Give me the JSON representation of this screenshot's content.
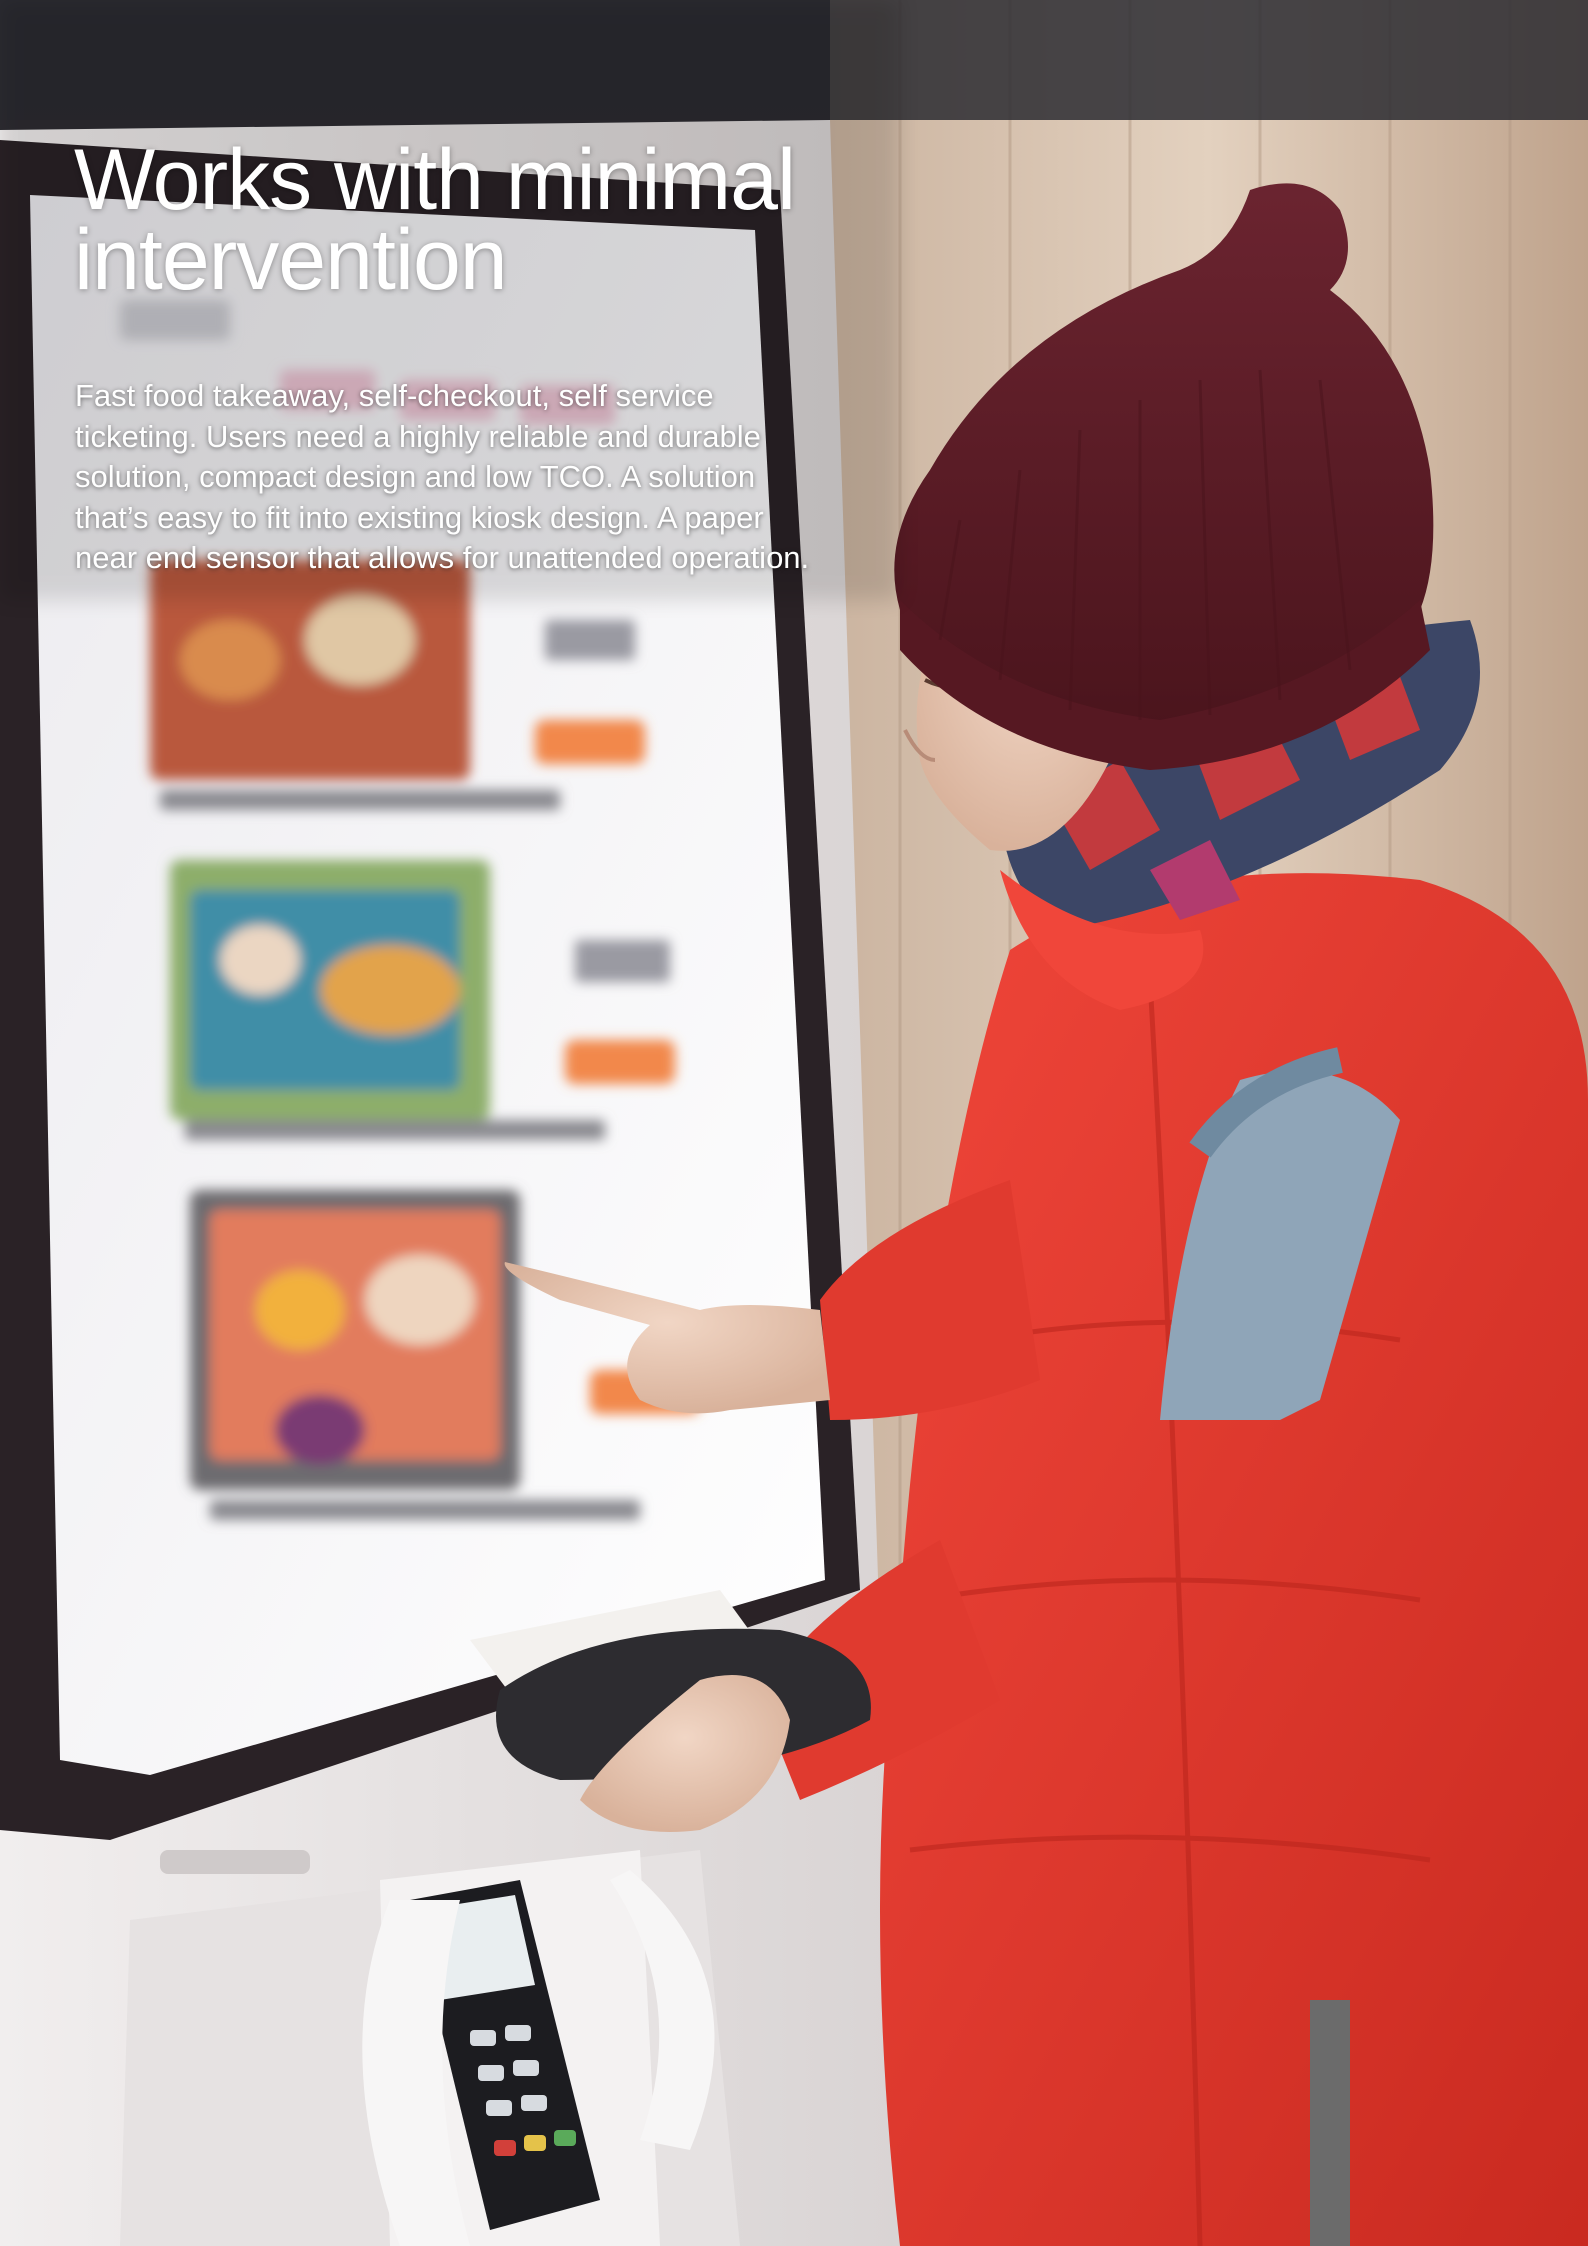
{
  "headline": {
    "line1": "Works with minimal",
    "line2": "intervention"
  },
  "body": {
    "lines": [
      "Fast food takeaway, self-checkout, self service",
      "ticketing. Users need a highly reliable and durable",
      "solution, compact design and low TCO. A solution",
      "that’s easy to fit into existing kiosk design. A paper",
      "near end sensor that allows for unattended operation."
    ]
  },
  "photo": {
    "subject": "woman-using-self-service-kiosk",
    "colors": {
      "jacket": "#e8392a",
      "hat": "#5a1a22",
      "kiosk_frame": "#2a2226",
      "wall": "#d9c6b4"
    }
  }
}
